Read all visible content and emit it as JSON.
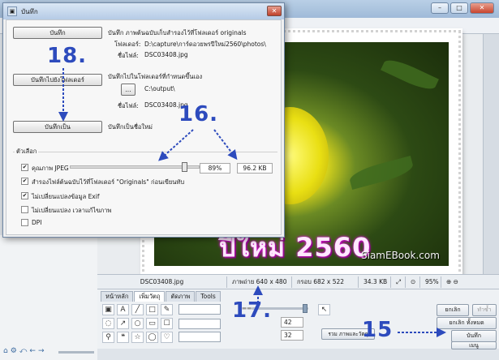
{
  "dialog": {
    "title": "บันทึก",
    "save_button": "บันทึก",
    "save_desc": "บันทึก  ภาพต้นฉบับเก็บสำรองไว้ที่โฟลเดอร์ originals",
    "folder_label": "โฟลเดอร์:",
    "folder_value": "D:\\capture\\การ์ดอวยพรปีใหม่2560\\photos\\",
    "filename_label": "ชื่อไฟล์:",
    "filename_value": "DSC03408.jpg",
    "save_to_folder_button": "บันทึกไปยังโฟลเดอร์",
    "save_to_folder_desc": "บันทึกไปในโฟลเดอร์ที่กำหนดขึ้นเอง",
    "browse_button": "...",
    "output_folder_value": "C:\\output\\",
    "filename_label2": "ชื่อไฟล์:",
    "filename_value2": "DSC03408.jpg",
    "save_as_copy_button": "บันทึกเป็น",
    "save_as_copy_desc": "บันทึกเป็นชื่อใหม่",
    "options_legend": "ตัวเลือก",
    "jpeg_quality_label": "คุณภาพ JPEG",
    "jpeg_quality_value": "89%",
    "file_size_value": "96.2 KB",
    "jpeg_quality": 0.89,
    "option_backup": "สำรองไฟล์ต้นฉบับไว้ที่โฟลเดอร์ \"Originals\" ก่อนเขียนทับ",
    "option_exif": "ไม่เปลี่ยนแปลงข้อมูล Exif",
    "option_time": "ไม่เปลี่ยนแปลง เวลาแก้ไขภาพ",
    "option_dpi": "DPI",
    "checkbox_mark": "✔"
  },
  "photo": {
    "caption": "ปีใหม่ 2560",
    "watermark": "SiamEBook.com"
  },
  "statusbar": {
    "filename": "DSC03408.jpg",
    "image_size": "ภาพถ่าย 640 x 480",
    "frame_size": "กรอบ 682 x 522",
    "file_size": "34.3 KB",
    "zoom": "95%"
  },
  "bottom_panel": {
    "tabs": [
      "หน้าหลัก",
      "เพิ่มวัตถุ",
      "ตัดภาพ",
      "Tools"
    ],
    "merge_button": "รวม ภาพและวัตถุ",
    "cancel_button": "ยกเลิก",
    "redo_button": "ทำซ้ำ",
    "cancel_all_button": "ยกเลิก ทั้งหมด",
    "save_button": "บันทึก",
    "menu_button": "เมนู",
    "spin_value_1": "42",
    "spin_value_2": "32"
  },
  "annotations": {
    "step_18": "18.",
    "step_16": "16.",
    "step_17": "17.",
    "step_15": "15"
  },
  "background_watermark": "SiamEBook.com",
  "colors": {
    "annotation": "#2d4bbd",
    "caption_glow": "#d11bc8"
  }
}
